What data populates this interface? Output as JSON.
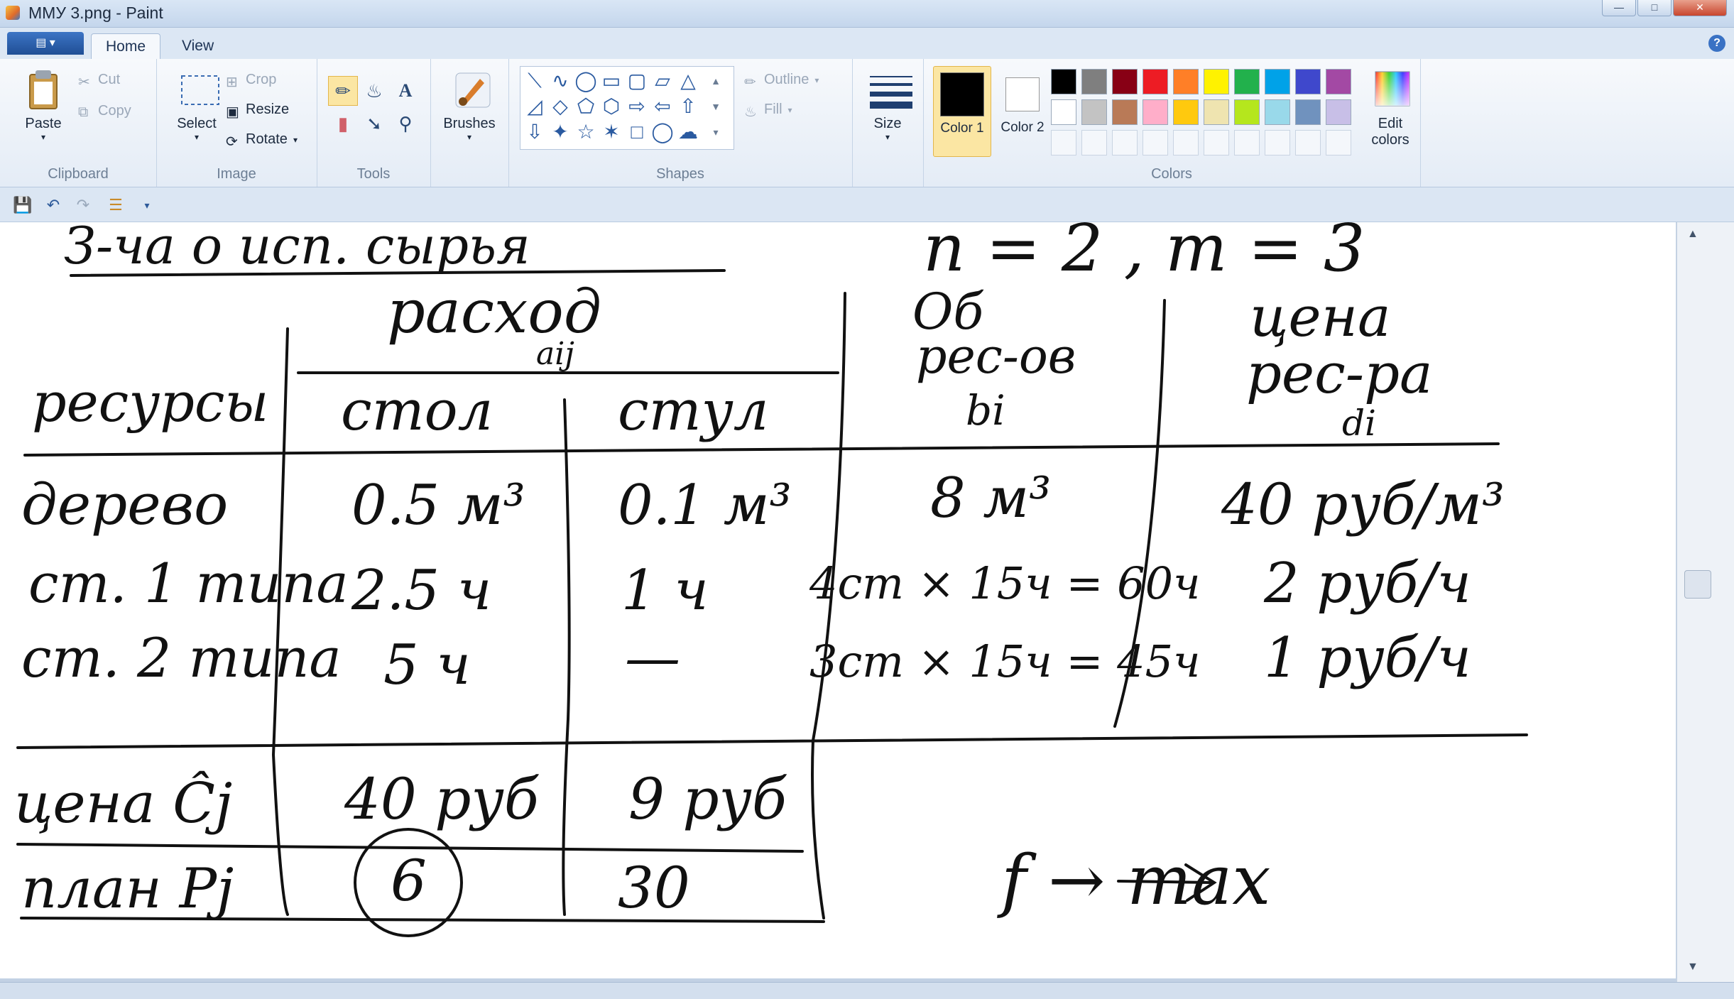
{
  "window": {
    "title": "ММУ 3.png - Paint"
  },
  "tabs": [
    {
      "label": "Home"
    },
    {
      "label": "View"
    }
  ],
  "ribbon": {
    "clipboard": {
      "label": "Clipboard",
      "paste": "Paste",
      "cut": "Cut",
      "copy": "Copy"
    },
    "image": {
      "label": "Image",
      "select": "Select",
      "crop": "Crop",
      "resize": "Resize",
      "rotate": "Rotate"
    },
    "tools": {
      "label": "Tools"
    },
    "brushes": {
      "label": "Brushes"
    },
    "shapes": {
      "label": "Shapes",
      "outline": "Outline",
      "fill": "Fill"
    },
    "size": {
      "label": "Size"
    },
    "colors": {
      "label": "Colors",
      "color1": "Color 1",
      "color1_num": "1",
      "color2": "Color 2",
      "color2_num": "2",
      "color1_value": "#000000",
      "color2_value": "#ffffff",
      "edit": "Edit colors",
      "palette_row1": [
        "#000000",
        "#7f7f7f",
        "#880015",
        "#ed1c24",
        "#ff7f27",
        "#fff200",
        "#22b14c",
        "#00a2e8",
        "#3f48cc",
        "#a349a4"
      ],
      "palette_row2": [
        "#ffffff",
        "#c3c3c3",
        "#b97a57",
        "#ffaec9",
        "#ffc90e",
        "#efe4b0",
        "#b5e61d",
        "#99d9ea",
        "#7092be",
        "#c8bfe7"
      ]
    }
  },
  "canvas": {
    "header_line": "З-ча о исп. сырья",
    "params": "n = 2 , m = 3",
    "col_rashod": "расход",
    "col_rashod_sub": "aij",
    "col_resource": "ресурсы",
    "col_stol": "стол",
    "col_stul": "стул",
    "col_obiem": "Об",
    "col_obiem2": "рес-ов",
    "col_obiem_sub": "bi",
    "col_cena": "цена",
    "col_cena2": "рес-ра",
    "col_cena_sub": "di",
    "rows": [
      {
        "name": "дерево",
        "stol": "0.5 м³",
        "stul": "0.1 м³",
        "obiem": "8 м³",
        "cena": "40 руб/м³"
      },
      {
        "name": "ст. 1 типа",
        "stol": "2.5 ч",
        "stul": "1 ч",
        "obiem": "4ст × 15ч = 60ч",
        "cena": "2 руб/ч"
      },
      {
        "name": "ст. 2 типа",
        "stol": "5 ч",
        "stul": "—",
        "obiem": "3ст × 15ч = 45ч",
        "cena": "1 руб/ч"
      }
    ],
    "price_row": {
      "name": "цена Ĉj",
      "stol": "40 руб",
      "stul": "9 руб"
    },
    "plan_row": {
      "name": "план Pj",
      "stol": "6",
      "stul": "30"
    },
    "objective": "f → max"
  }
}
